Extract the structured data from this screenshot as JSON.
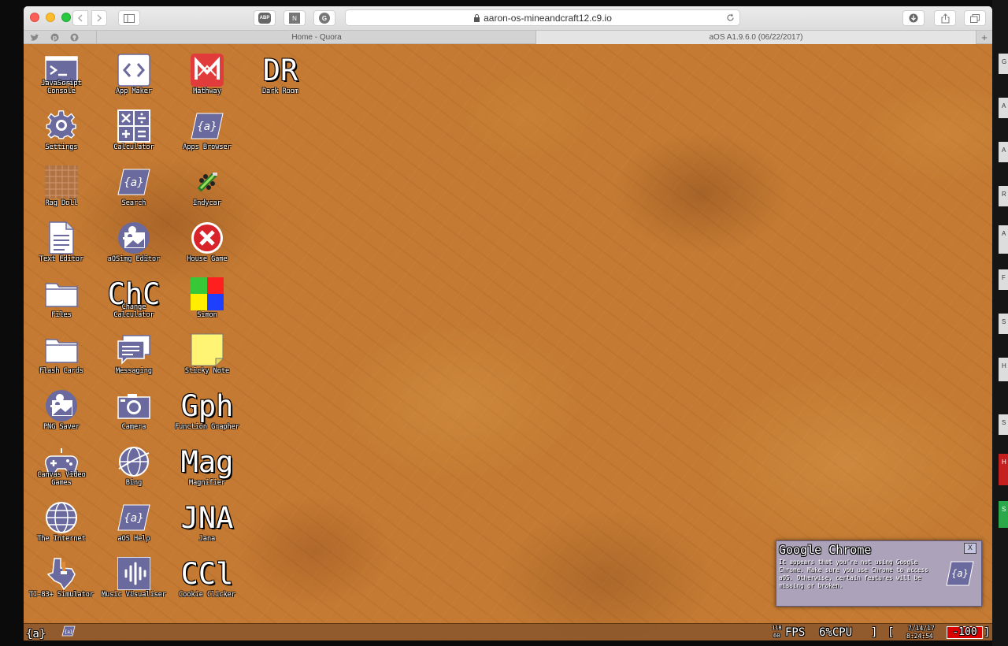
{
  "browser": {
    "address_url": "aaron-os-mineandcraft12.c9.io",
    "tabs": [
      {
        "title": "Home - Quora"
      },
      {
        "title": "aOS A1.9.6.0 (06/22/2017)"
      }
    ],
    "ext_abp": "ABP",
    "ext_2": "N",
    "ext_3": "G",
    "new_tab": "+"
  },
  "desktop": {
    "icons": [
      {
        "label": "JavaScript Console",
        "icon": "terminal-icon"
      },
      {
        "label": "App Maker",
        "icon": "code-icon"
      },
      {
        "label": "Mathway",
        "icon": "mathway-logo-icon"
      },
      {
        "label": "Dark Room",
        "icon": "text-icon",
        "glyph": "DR"
      },
      {
        "label": "Settings",
        "icon": "gear-icon"
      },
      {
        "label": "Calculator",
        "icon": "calculator-icon"
      },
      {
        "label": "Apps Browser",
        "icon": "aos-logo-icon"
      },
      {
        "label": "Rag Doll",
        "icon": "ragdoll-icon"
      },
      {
        "label": "Search",
        "icon": "aos-logo-icon"
      },
      {
        "label": "Indycar",
        "icon": "race-car-icon"
      },
      {
        "label": "Text Editor",
        "icon": "document-icon"
      },
      {
        "label": "aOSimg Editor",
        "icon": "image-editor-icon"
      },
      {
        "label": "House Game",
        "icon": "error-x-icon"
      },
      {
        "label": "Files",
        "icon": "folder-icon"
      },
      {
        "label": "Change Calculator",
        "icon": "text-icon",
        "glyph": "ChC"
      },
      {
        "label": "Simon",
        "icon": "simon-squares-icon"
      },
      {
        "label": "Flash Cards",
        "icon": "folder-icon"
      },
      {
        "label": "Messaging",
        "icon": "chat-icon"
      },
      {
        "label": "Sticky Note",
        "icon": "sticky-note-icon"
      },
      {
        "label": "PNG Saver",
        "icon": "image-editor-icon"
      },
      {
        "label": "Camera",
        "icon": "camera-icon"
      },
      {
        "label": "Function Grapher",
        "icon": "text-icon",
        "glyph": "Gph"
      },
      {
        "label": "Canvas Video Games",
        "icon": "gamepad-icon"
      },
      {
        "label": "Bing",
        "icon": "globe-icon"
      },
      {
        "label": "Magnifier",
        "icon": "text-icon",
        "glyph": "Mag"
      },
      {
        "label": "The Internet",
        "icon": "globe-icon"
      },
      {
        "label": "aOS Help",
        "icon": "aos-logo-icon"
      },
      {
        "label": "Jana",
        "icon": "text-icon",
        "glyph": "JNA"
      },
      {
        "label": "TI-83+ Simulator",
        "icon": "texas-icon"
      },
      {
        "label": "Music Visualiser",
        "icon": "waveform-icon"
      },
      {
        "label": "Cookie Clicker",
        "icon": "text-icon",
        "glyph": "CCl"
      }
    ]
  },
  "notification": {
    "title": "Google Chrome",
    "body": "It appears that you're not using Google Chrome. Make sure you use Chrome to access aOS. Otherwise, certain features will be missing or broken.",
    "close_label": "X",
    "logo": "{a}"
  },
  "taskbar": {
    "start_label": "{a}",
    "fps_top": "118",
    "fps_bottom": "60",
    "fps_label": "FPS",
    "cpu_label": "6%CPU",
    "bracket_close": "]",
    "bracket_open": "[",
    "date": "7/14/17",
    "time": "8:24:54",
    "battery": "-100",
    "bracket_end": "]"
  },
  "right_strip": [
    "G",
    "A",
    "A",
    "R",
    "A",
    "F",
    "S",
    "H",
    "S",
    "H",
    "S"
  ],
  "colors": {
    "icon_purple": "#6a6a9e",
    "desktop_base": "#c47a32",
    "battery_red": "#d90000"
  }
}
